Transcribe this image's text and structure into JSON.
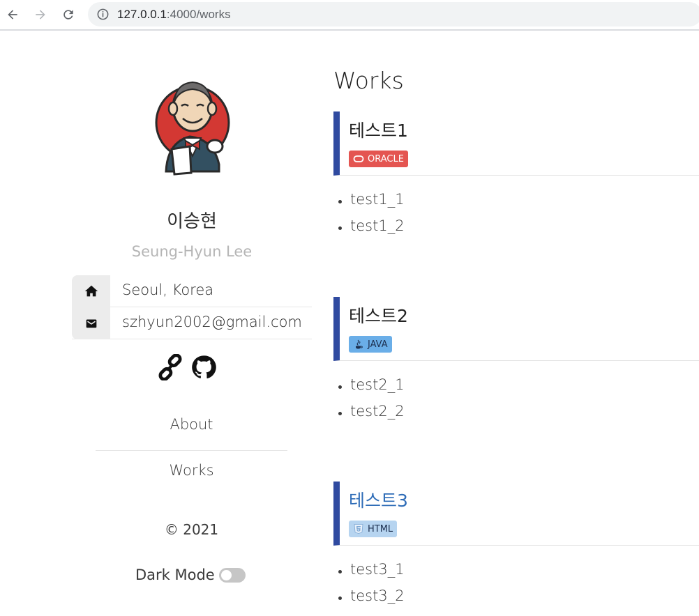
{
  "browser": {
    "url_host": "127.0.0.1",
    "url_path": ":4000/works"
  },
  "profile": {
    "name_ko": "이승현",
    "name_en": "Seung-Hyun Lee",
    "location": "Seoul, Korea",
    "email": "szhyun2002@gmail.com"
  },
  "nav": {
    "about": "About",
    "works": "Works"
  },
  "footer": {
    "copyright": "© 2021",
    "dark_mode_label": "Dark Mode",
    "dark_mode_on": false
  },
  "main": {
    "title": "Works",
    "works": [
      {
        "title": "테스트1",
        "badge": "ORACLE",
        "badge_icon": "oracle-icon",
        "badge_color": "#e45551",
        "items": [
          "test1_1",
          "test1_2"
        ]
      },
      {
        "title": "테스트2",
        "badge": "JAVA",
        "badge_icon": "java-icon",
        "badge_color": "#6aaee8",
        "items": [
          "test2_1",
          "test2_2"
        ]
      },
      {
        "title": "테스트3",
        "badge": "HTML",
        "badge_icon": "html5-icon",
        "badge_color": "#b6d4f0",
        "items": [
          "test3_1",
          "test3_2"
        ]
      }
    ]
  },
  "colors": {
    "accent_bar": "#2f4aa0",
    "link": "#2e6cb7",
    "subtitle": "#b5b5b5"
  }
}
